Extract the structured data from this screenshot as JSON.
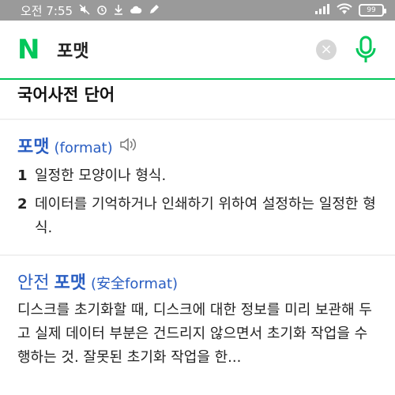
{
  "statusbar": {
    "time": "오전 7:55",
    "battery": "99",
    "icons": [
      "mute-icon",
      "alarm-icon",
      "download-icon",
      "cloud-icon",
      "edit-icon",
      "signal-icon",
      "wifi-icon",
      "battery-icon"
    ]
  },
  "search": {
    "logo": "N",
    "query": "포맷",
    "accent": "#03c75a"
  },
  "section": {
    "title": "국어사전 단어"
  },
  "entries": [
    {
      "headword": "포맷",
      "origin": "(format)",
      "senses": [
        {
          "num": "1",
          "text": "일정한 모양이나 형식."
        },
        {
          "num": "2",
          "text": "데이터를 기억하거나 인쇄하기 위하여 설정하는 일정한 형식."
        }
      ]
    },
    {
      "prefix": "안전",
      "headword": "포맷",
      "origin": "(安全format)",
      "description": "디스크를 초기화할 때, 디스크에 대한 정보를 미리 보관해 두고 실제 데이터 부분은 건드리지 않으면서 초기화 작업을 수행하는 것. 잘못된 초기화 작업을 한..."
    }
  ],
  "colors": {
    "link": "#2a5ec2",
    "statusbar": "#9a9a9a"
  }
}
